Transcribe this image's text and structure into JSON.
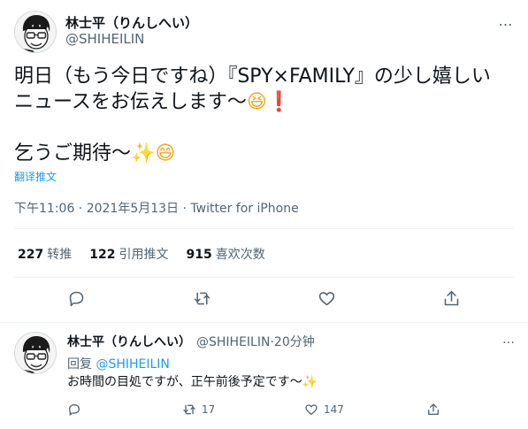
{
  "main": {
    "author_name": "林士平（りんしへい）",
    "author_handle": "@SHIHEILIN",
    "more_icon": "…",
    "text_line1": "明日（もう今日ですね）『SPY×FAMILY』の少し嬉しい",
    "text_line2": "ニュースをお伝えします〜",
    "emoji_laugh": "😆",
    "emoji_excl": "❗",
    "text_line3": "乞うご期待〜",
    "emoji_sparkle": "✨",
    "emoji_grin": "😄",
    "translate_label": "翻译推文",
    "timestamp": "下午11:06 · 2021年5月13日 · Twitter for iPhone",
    "stats": [
      {
        "count": "227",
        "label": "转推"
      },
      {
        "count": "122",
        "label": "引用推文"
      },
      {
        "count": "915",
        "label": "喜欢次数"
      }
    ]
  },
  "reply": {
    "author_name": "林士平（りんしへい）",
    "author_handle": "@SHIHEILIN",
    "dot": "·",
    "time": "20分钟",
    "more_icon": "…",
    "reply_prefix": "回复",
    "reply_to": "@SHIHEILIN",
    "text": "お時間の目処ですが、正午前後予定です〜",
    "emoji_sparkle": "✨",
    "retweet_count": "17",
    "like_count": "147"
  }
}
